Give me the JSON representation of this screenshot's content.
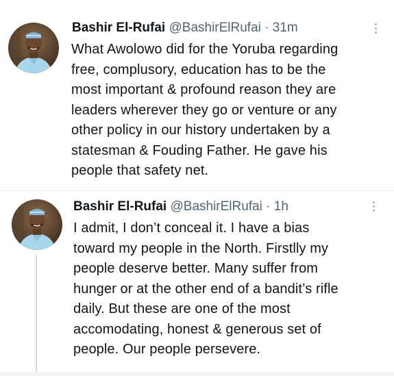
{
  "tweets": [
    {
      "author_name": "Bashir El-Rufai",
      "handle": "@BashirElRufai",
      "separator": "·",
      "time": "31m",
      "text": "What Awolowo did for the Yoruba regarding\nfree, complusory, education has to be the\nmost important & profound reason they are\nleaders wherever they go or venture or any\nother policy in our history undertaken by a\nstatesman & Fouding Father. He gave his\npeople that safety net."
    },
    {
      "author_name": "Bashir El-Rufai",
      "handle": "@BashirElRufai",
      "separator": "·",
      "time": "1h",
      "text": "I admit, I don’t conceal it. I have a bias\ntoward my people in the North. Firstlly my\npeople deserve better. Many suffer from\nhunger or at the other end of a bandit’s rifle\ndaily. But these are one of the most\naccomodating, honest & generous set of\npeople. Our people persevere."
    }
  ],
  "icons": {
    "more": "more-vertical-icon",
    "avatar": "user-avatar"
  },
  "colors": {
    "text": "#0f1419",
    "secondary": "#536471",
    "divider": "#e6ecf0",
    "thread_line": "#cfd9de"
  }
}
